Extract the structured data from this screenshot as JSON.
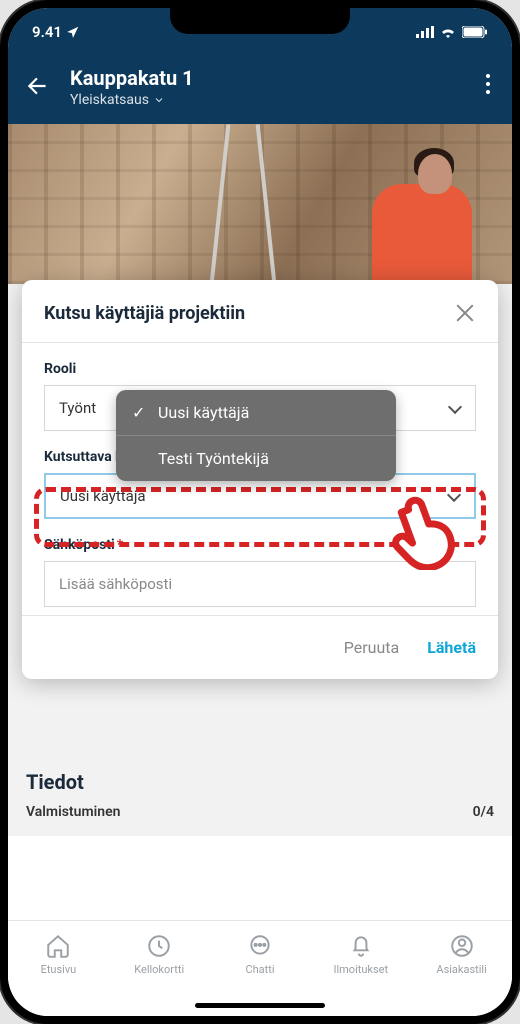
{
  "status": {
    "time": "9.41"
  },
  "header": {
    "title": "Kauppakatu 1",
    "subtitle": "Yleiskatsaus"
  },
  "section": {
    "title": "Tiedot",
    "progress_label": "Valmistuminen",
    "progress_value": "0/4"
  },
  "modal": {
    "title": "Kutsu käyttäjiä projektiin",
    "role_label": "Rooli",
    "role_value": "Työnt",
    "person_label": "Kutsuttava henkilö",
    "person_value": "Uusi käyttäjä",
    "email_label": "Sähköposti",
    "email_placeholder": "Lisää sähköposti",
    "cancel": "Peruuta",
    "submit": "Lähetä"
  },
  "dropdown": {
    "items": [
      {
        "label": "Uusi käyttäjä",
        "selected": true
      },
      {
        "label": "Testi Työntekijä",
        "selected": false
      }
    ]
  },
  "nav": {
    "items": [
      {
        "label": "Etusivu"
      },
      {
        "label": "Kellokortti"
      },
      {
        "label": "Chatti"
      },
      {
        "label": "Ilmoitukset"
      },
      {
        "label": "Asiakastili"
      }
    ]
  }
}
